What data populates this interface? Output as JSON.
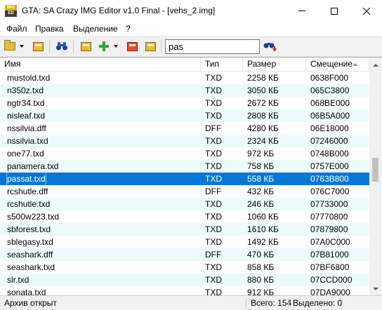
{
  "window": {
    "title": "GTA: SA Crazy IMG Editor v1.0 Final - [vehs_2.img]",
    "icon_text_top": "IMG",
    "icon_text_bottom": "ED"
  },
  "menu": {
    "items": [
      {
        "label": "Файл"
      },
      {
        "label": "Правка"
      },
      {
        "label": "Выделение"
      },
      {
        "label": "?"
      }
    ]
  },
  "toolbar": {
    "icons": [
      "open-folder-icon",
      "open-dropdown-arrow-icon",
      "rebuild-archive-icon",
      "find-icon",
      "extract-icon",
      "add-icon",
      "add-dropdown-arrow-icon",
      "delete-icon",
      "replace-icon",
      "find-next-icon"
    ],
    "search_value": "pas"
  },
  "list": {
    "columns": [
      {
        "label": "Имя"
      },
      {
        "label": "Тип"
      },
      {
        "label": "Размер"
      },
      {
        "label": "Смещение"
      }
    ],
    "selected_index": 8,
    "rows": [
      {
        "name": "mustold.txd",
        "type": "TXD",
        "size": "2258 КБ",
        "offset": "0638F000"
      },
      {
        "name": "n350z.txd",
        "type": "TXD",
        "size": "3050 КБ",
        "offset": "065C3800"
      },
      {
        "name": "ngtr34.txd",
        "type": "TXD",
        "size": "2672 КБ",
        "offset": "068BE000"
      },
      {
        "name": "nisleaf.txd",
        "type": "TXD",
        "size": "2808 КБ",
        "offset": "06B5A000"
      },
      {
        "name": "nssilvia.dff",
        "type": "DFF",
        "size": "4280 КБ",
        "offset": "06E18000"
      },
      {
        "name": "nssilvia.txd",
        "type": "TXD",
        "size": "2324 КБ",
        "offset": "07246000"
      },
      {
        "name": "one77.txd",
        "type": "TXD",
        "size": "972 КБ",
        "offset": "0748B000"
      },
      {
        "name": "panamera.txd",
        "type": "TXD",
        "size": "758 КБ",
        "offset": "0757E000"
      },
      {
        "name": "passat.txd",
        "type": "TXD",
        "size": "558 КБ",
        "offset": "0763B800"
      },
      {
        "name": "rcshutle.dff",
        "type": "DFF",
        "size": "432 КБ",
        "offset": "076C7000"
      },
      {
        "name": "rcshutle.txd",
        "type": "TXD",
        "size": "246 КБ",
        "offset": "07733000"
      },
      {
        "name": "s500w223.txd",
        "type": "TXD",
        "size": "1060 КБ",
        "offset": "07770800"
      },
      {
        "name": "sbforest.txd",
        "type": "TXD",
        "size": "1610 КБ",
        "offset": "07879800"
      },
      {
        "name": "sblegasy.txd",
        "type": "TXD",
        "size": "1492 КБ",
        "offset": "07A0C000"
      },
      {
        "name": "seashark.dff",
        "type": "DFF",
        "size": "470 КБ",
        "offset": "07B81000"
      },
      {
        "name": "seashark.txd",
        "type": "TXD",
        "size": "858 КБ",
        "offset": "07BF6800"
      },
      {
        "name": "slr.txd",
        "type": "TXD",
        "size": "880 КБ",
        "offset": "07CCD000"
      },
      {
        "name": "sonata.txd",
        "type": "TXD",
        "size": "912 КБ",
        "offset": "07DA9000"
      }
    ]
  },
  "status": {
    "left": "Архив открыт",
    "total": "Всего: 154",
    "selected": "Выделено: 0"
  },
  "colors": {
    "selection": "#0078d7",
    "alt_row": "#eefbfb"
  }
}
